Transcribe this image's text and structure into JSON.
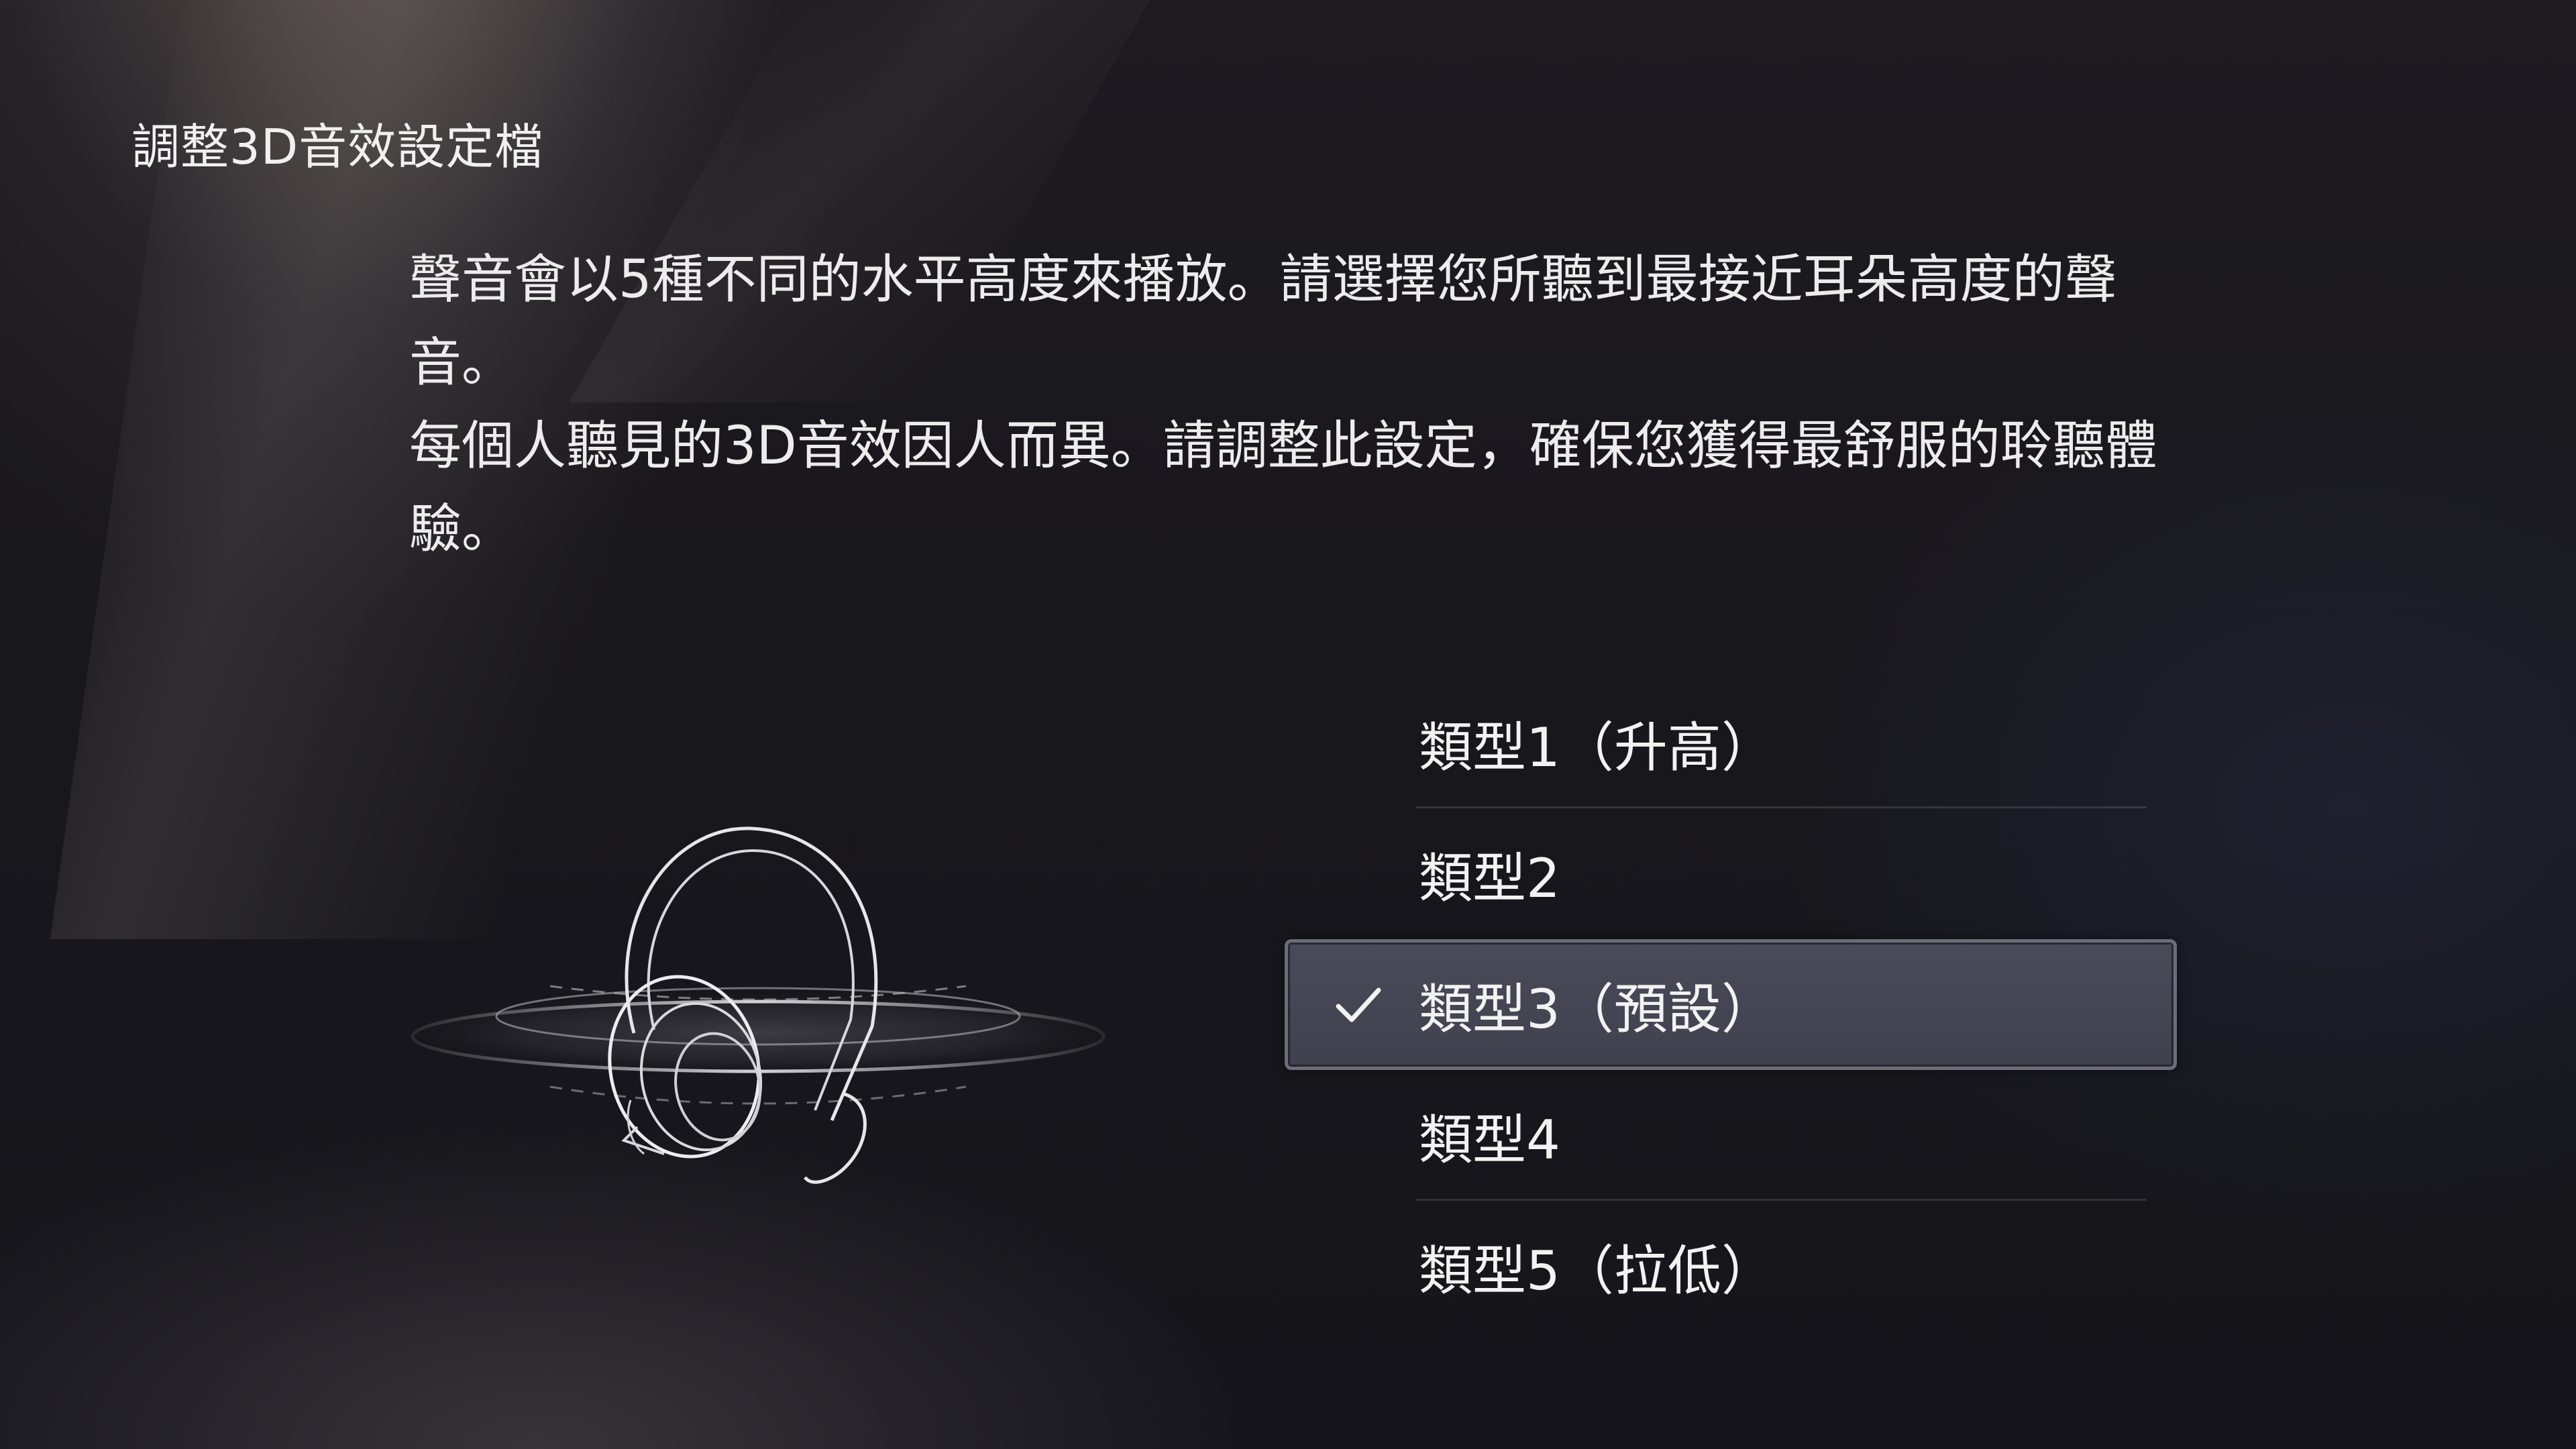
{
  "header": {
    "title": "調整3D音效設定檔"
  },
  "description": {
    "paragraph1": "聲音會以5種不同的水平高度來播放。請選擇您所聽到最接近耳朵高度的聲音。",
    "paragraph2": "每個人聽見的3D音效因人而異。請調整此設定，確保您獲得最舒服的聆聽體驗。"
  },
  "illustration": {
    "icon": "headset-icon"
  },
  "options": {
    "selected_index": 2,
    "items": [
      {
        "label": "類型1（升高）"
      },
      {
        "label": "類型2"
      },
      {
        "label": "類型3（預設）",
        "icon": "checkmark-icon"
      },
      {
        "label": "類型4"
      },
      {
        "label": "類型5（拉低）"
      }
    ]
  },
  "colors": {
    "background": "#18171c",
    "selected_background": "#454754",
    "selected_border": "#6b6d78",
    "text": "#f2f2f2"
  }
}
